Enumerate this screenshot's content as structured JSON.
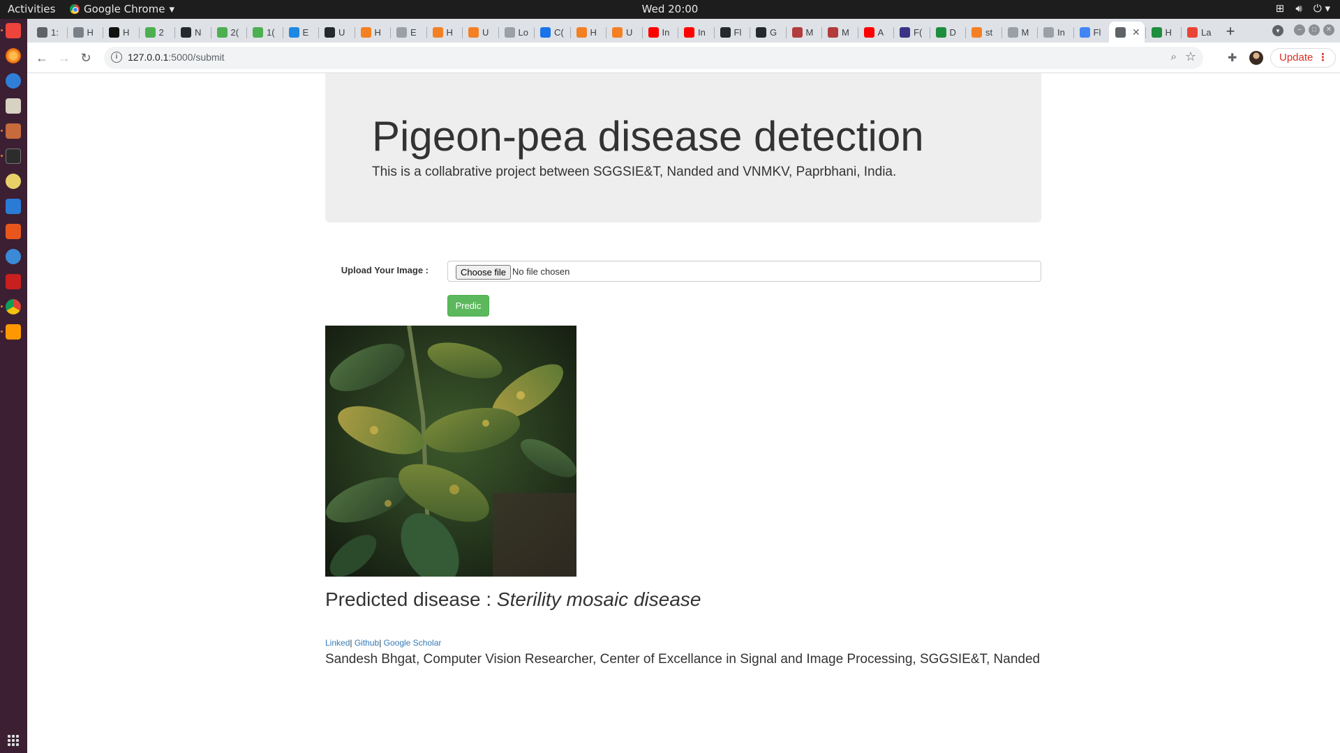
{
  "topbar": {
    "activities": "Activities",
    "app_name": "Google Chrome",
    "clock": "Wed 20:00"
  },
  "tabs": [
    {
      "label": "1:",
      "color": "#5f6368"
    },
    {
      "label": "H",
      "color": "#7a8088"
    },
    {
      "label": "H",
      "color": "#111111"
    },
    {
      "label": "2",
      "color": "#4caf50"
    },
    {
      "label": "N",
      "color": "#24292e"
    },
    {
      "label": "2(",
      "color": "#4caf50"
    },
    {
      "label": "1(",
      "color": "#4caf50"
    },
    {
      "label": "E",
      "color": "#1e88e5"
    },
    {
      "label": "U",
      "color": "#24292e"
    },
    {
      "label": "H",
      "color": "#f48024"
    },
    {
      "label": "E",
      "color": "#9aa0a6"
    },
    {
      "label": "H",
      "color": "#f48024"
    },
    {
      "label": "U",
      "color": "#f48024"
    },
    {
      "label": "Lo",
      "color": "#9aa0a6"
    },
    {
      "label": "C(",
      "color": "#1a73e8"
    },
    {
      "label": "H",
      "color": "#f48024"
    },
    {
      "label": "U",
      "color": "#f48024"
    },
    {
      "label": "In",
      "color": "#ff0000"
    },
    {
      "label": "In",
      "color": "#ff0000"
    },
    {
      "label": "Fl",
      "color": "#24292e"
    },
    {
      "label": "G",
      "color": "#24292e"
    },
    {
      "label": "M",
      "color": "#b23b3b"
    },
    {
      "label": "M",
      "color": "#b23b3b"
    },
    {
      "label": "A",
      "color": "#ff0000"
    },
    {
      "label": "F(",
      "color": "#3b3486"
    },
    {
      "label": "D",
      "color": "#1e8e3e"
    },
    {
      "label": "st",
      "color": "#f48024"
    },
    {
      "label": "M",
      "color": "#9aa0a6"
    },
    {
      "label": "In",
      "color": "#9aa0a6"
    },
    {
      "label": "Fl",
      "color": "#4285f4"
    },
    {
      "label": "",
      "color": "#5f6368",
      "active": true
    },
    {
      "label": "H",
      "color": "#1e8e3e"
    },
    {
      "label": "La",
      "color": "#ea4335"
    }
  ],
  "toolbar": {
    "url_host": "127.0.0.1",
    "url_path": ":5000/submit",
    "update_label": "Update"
  },
  "page": {
    "title": "Pigeon-pea disease detection",
    "subtitle": "This is a collabrative project between SGGSIE&T, Nanded and VNMKV, Paprbhani, India.",
    "upload_label": "Upload Your Image :",
    "choose_file": "Choose file",
    "file_status": "No file chosen",
    "predict_button": "Predic",
    "result_prefix": "Predicted disease : ",
    "result_value": "Sterility mosaic disease",
    "footer_links": [
      "Linked",
      "Github",
      "Google Scholar"
    ],
    "footer_credit": "Sandesh Bhgat, Computer Vision Researcher, Center of Excellance in Signal and Image Processing, SGGSIE&T, Nanded"
  },
  "colors": {
    "primary_button": "#5cb85c",
    "link": "#337ab7",
    "jumbotron_bg": "#eeeeee",
    "dock_bg": "#3c1f33"
  }
}
